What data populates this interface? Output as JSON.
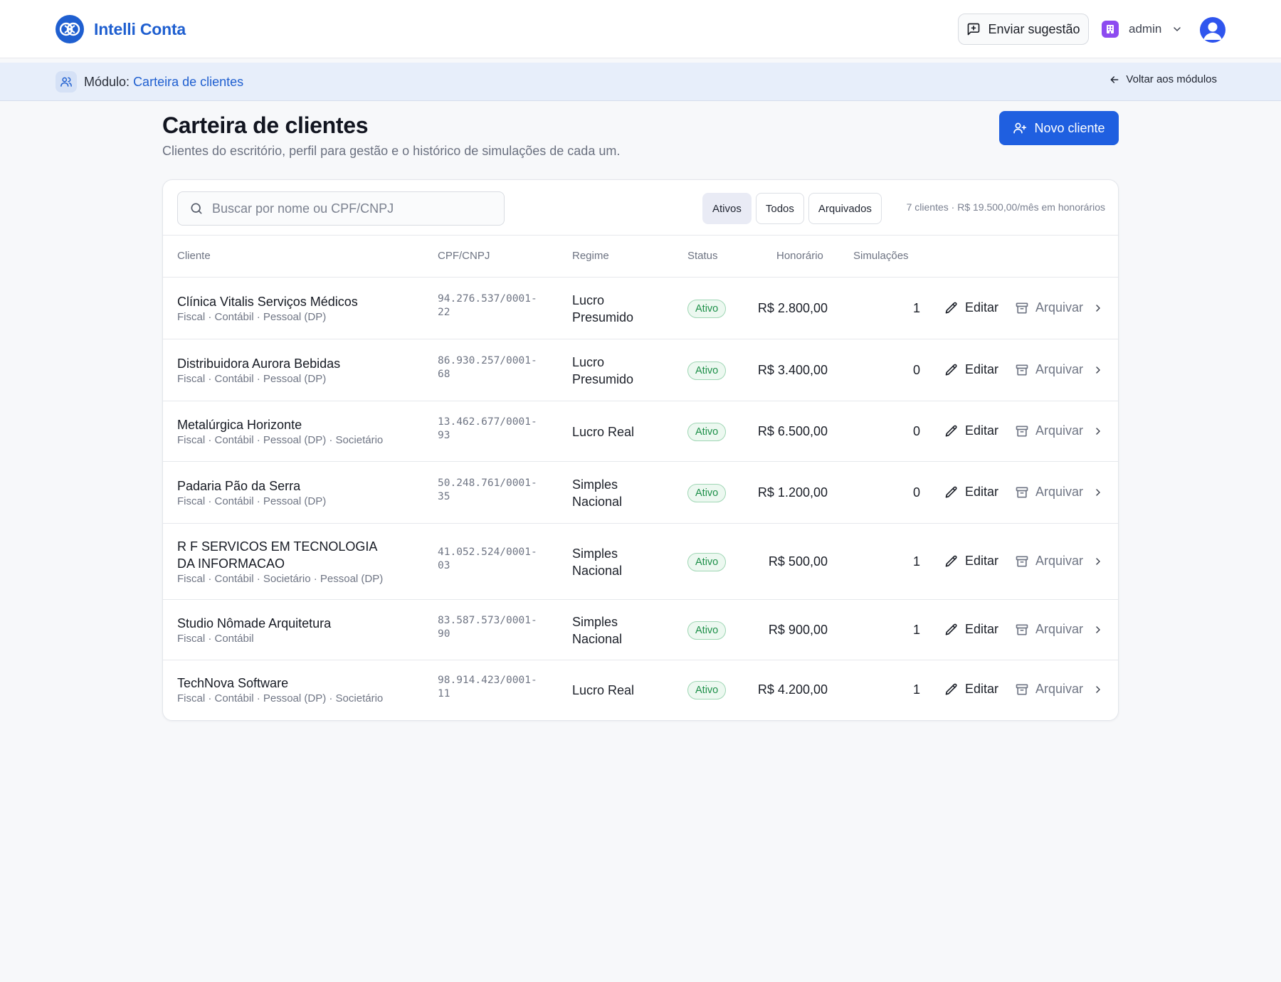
{
  "app": {
    "name": "Intelli Conta"
  },
  "header": {
    "suggest_label": "Enviar sugestão",
    "user_name": "admin"
  },
  "module_bar": {
    "prefix": "Módulo:",
    "module_name": "Carteira de clientes",
    "back_label": "Voltar aos módulos"
  },
  "page": {
    "title": "Carteira de clientes",
    "subtitle": "Clientes do escritório, perfil para gestão e o histórico de simulações de cada um.",
    "new_button_label": "Novo cliente"
  },
  "toolbar": {
    "search_placeholder": "Buscar por nome ou CPF/CNPJ",
    "filters": [
      "Ativos",
      "Todos",
      "Arquivados"
    ],
    "active_filter": "Ativos",
    "summary": "7 clientes · R$ 19.500,00/mês em honorários"
  },
  "table": {
    "headers": {
      "client": "Cliente",
      "cnpj": "CPF/CNPJ",
      "regime": "Regime",
      "status": "Status",
      "fee": "Honorário",
      "sims": "Simulações"
    },
    "edit_label": "Editar",
    "archive_label": "Arquivar",
    "rows": [
      {
        "name": "Clínica Vitalis Serviços Médicos",
        "tags": "Fiscal · Contábil · Pessoal (DP)",
        "cnpj": "94.276.537/0001-22",
        "regime": "Lucro Presumido",
        "status": "Ativo",
        "fee": "R$ 2.800,00",
        "sims": "1"
      },
      {
        "name": "Distribuidora Aurora Bebidas",
        "tags": "Fiscal · Contábil · Pessoal (DP)",
        "cnpj": "86.930.257/0001-68",
        "regime": "Lucro Presumido",
        "status": "Ativo",
        "fee": "R$ 3.400,00",
        "sims": "0"
      },
      {
        "name": "Metalúrgica Horizonte",
        "tags": "Fiscal · Contábil · Pessoal (DP) · Societário",
        "cnpj": "13.462.677/0001-93",
        "regime": "Lucro Real",
        "status": "Ativo",
        "fee": "R$ 6.500,00",
        "sims": "0"
      },
      {
        "name": "Padaria Pão da Serra",
        "tags": "Fiscal · Contábil · Pessoal (DP)",
        "cnpj": "50.248.761/0001-35",
        "regime": "Simples Nacional",
        "status": "Ativo",
        "fee": "R$ 1.200,00",
        "sims": "0"
      },
      {
        "name": "R F SERVICOS EM TECNOLOGIA DA INFORMACAO",
        "tags": "Fiscal · Contábil · Societário · Pessoal (DP)",
        "cnpj": "41.052.524/0001-03",
        "regime": "Simples Nacional",
        "status": "Ativo",
        "fee": "R$ 500,00",
        "sims": "1"
      },
      {
        "name": "Studio Nômade Arquitetura",
        "tags": "Fiscal · Contábil",
        "cnpj": "83.587.573/0001-90",
        "regime": "Simples Nacional",
        "status": "Ativo",
        "fee": "R$ 900,00",
        "sims": "1"
      },
      {
        "name": "TechNova Software",
        "tags": "Fiscal · Contábil · Pessoal (DP) · Societário",
        "cnpj": "98.914.423/0001-11",
        "regime": "Lucro Real",
        "status": "Ativo",
        "fee": "R$ 4.200,00",
        "sims": "1"
      }
    ]
  },
  "colors": {
    "brand": "#1f5fd0",
    "primary_button": "#1f5fe0",
    "status_green": "#1c8f48",
    "module_bar_bg": "#e7eefa",
    "user_badge": "#8d4bf0"
  },
  "icons": {
    "logo": "intelli-conta-logo-icon",
    "suggest": "message-square-plus-icon",
    "user_badge": "building-icon",
    "user_menu": "chevron-down-icon",
    "avatar": "user-avatar-icon",
    "module": "users-icon",
    "back": "arrow-left-icon",
    "new_client": "user-plus-icon",
    "search": "search-icon",
    "edit": "pencil-icon",
    "archive": "archive-icon",
    "row_open": "chevron-right-icon"
  }
}
